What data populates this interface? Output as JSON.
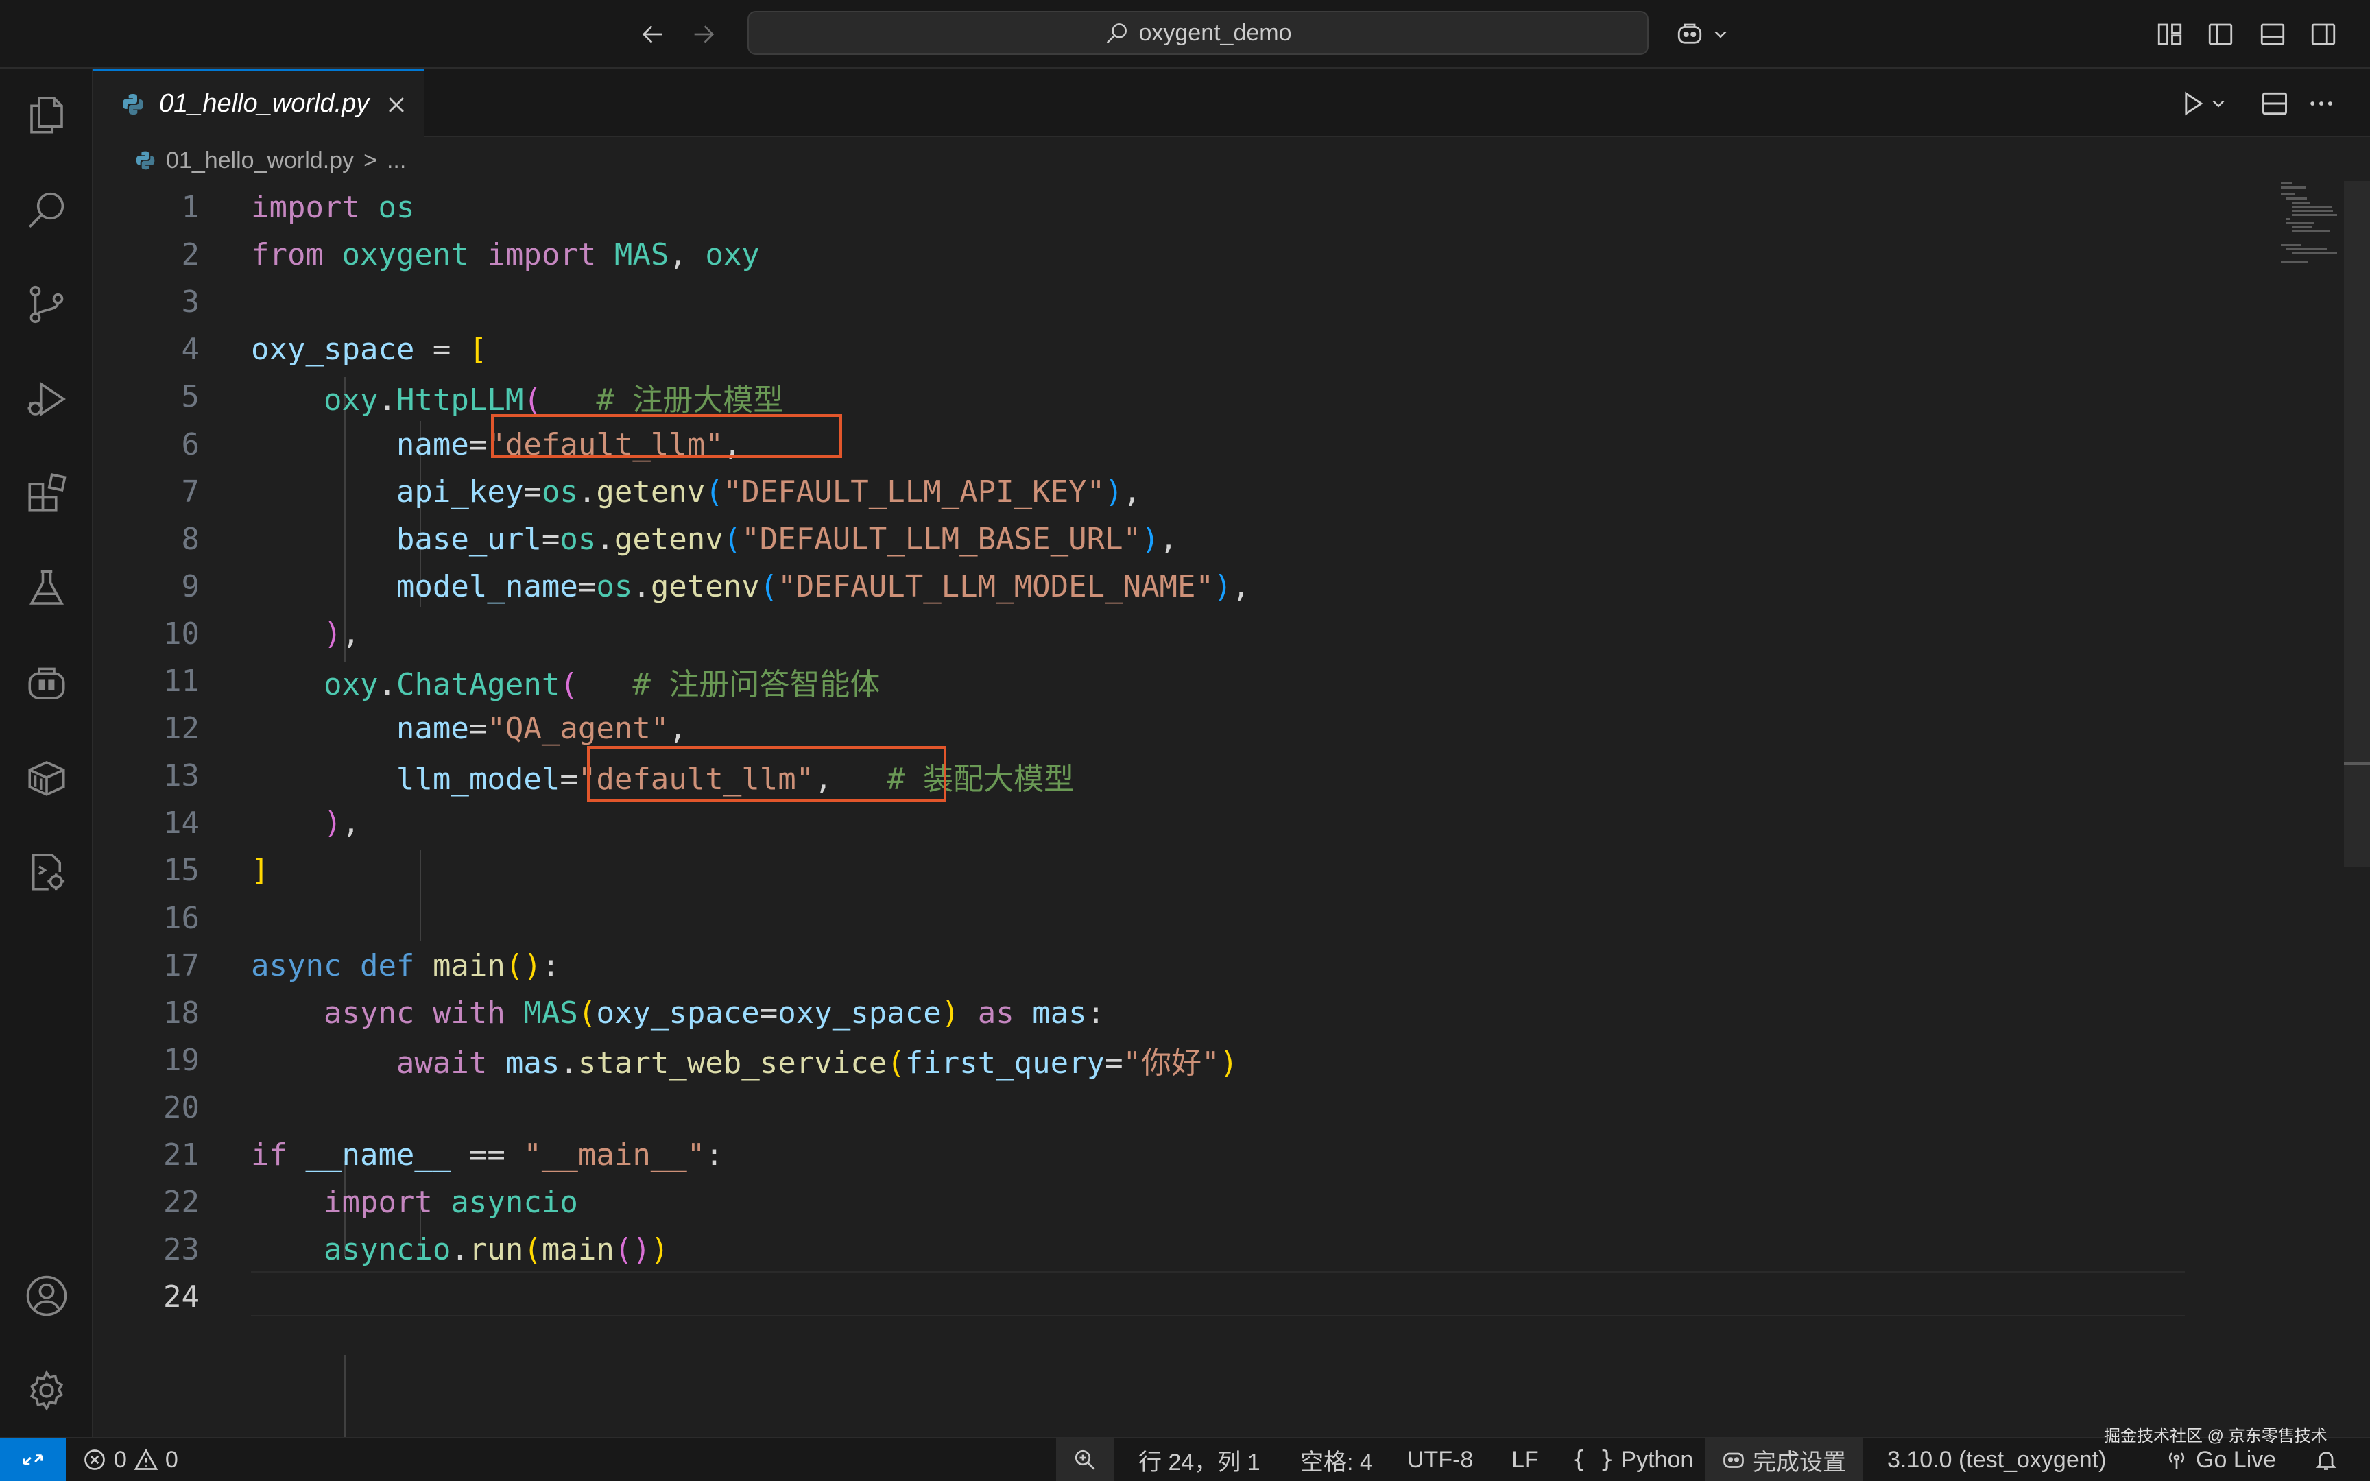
{
  "titlebar": {
    "search_text": "oxygent_demo"
  },
  "tab": {
    "filename": "01_hello_world.py"
  },
  "breadcrumb": {
    "file": "01_hello_world.py",
    "separator": ">",
    "more": "..."
  },
  "code": [
    {
      "n": "1",
      "t": [
        [
          "import",
          "#c586c0"
        ],
        [
          " ",
          ""
        ],
        [
          "os",
          "#4ec9b0"
        ]
      ]
    },
    {
      "n": "2",
      "t": [
        [
          "from",
          "#c586c0"
        ],
        [
          " ",
          ""
        ],
        [
          "oxygent",
          "#4ec9b0"
        ],
        [
          " ",
          ""
        ],
        [
          "import",
          "#c586c0"
        ],
        [
          " ",
          ""
        ],
        [
          "MAS",
          "#4ec9b0"
        ],
        [
          ", ",
          "#d4d4d4"
        ],
        [
          "oxy",
          "#4ec9b0"
        ]
      ]
    },
    {
      "n": "3",
      "t": []
    },
    {
      "n": "4",
      "t": [
        [
          "oxy_space",
          "#9cdcfe"
        ],
        [
          " = ",
          "#d4d4d4"
        ],
        [
          "[",
          "#ffd700"
        ]
      ]
    },
    {
      "n": "5",
      "t": [
        [
          "    ",
          ""
        ],
        [
          "oxy",
          "#4ec9b0"
        ],
        [
          ".",
          "#d4d4d4"
        ],
        [
          "HttpLLM",
          "#4ec9b0"
        ],
        [
          "(",
          "#da70d6"
        ],
        [
          "   ",
          ""
        ],
        [
          "# 注册大模型",
          "#6a9955"
        ]
      ]
    },
    {
      "n": "6",
      "t": [
        [
          "        ",
          ""
        ],
        [
          "name",
          "#9cdcfe"
        ],
        [
          "=",
          "#d4d4d4"
        ],
        [
          "\"default_llm\"",
          "#ce9178"
        ],
        [
          ",",
          "#d4d4d4"
        ]
      ]
    },
    {
      "n": "7",
      "t": [
        [
          "        ",
          ""
        ],
        [
          "api_key",
          "#9cdcfe"
        ],
        [
          "=",
          "#d4d4d4"
        ],
        [
          "os",
          "#4ec9b0"
        ],
        [
          ".",
          "#d4d4d4"
        ],
        [
          "getenv",
          "#dcdcaa"
        ],
        [
          "(",
          "#179fff"
        ],
        [
          "\"DEFAULT_LLM_API_KEY\"",
          "#ce9178"
        ],
        [
          ")",
          "#179fff"
        ],
        [
          ",",
          "#d4d4d4"
        ]
      ]
    },
    {
      "n": "8",
      "t": [
        [
          "        ",
          ""
        ],
        [
          "base_url",
          "#9cdcfe"
        ],
        [
          "=",
          "#d4d4d4"
        ],
        [
          "os",
          "#4ec9b0"
        ],
        [
          ".",
          "#d4d4d4"
        ],
        [
          "getenv",
          "#dcdcaa"
        ],
        [
          "(",
          "#179fff"
        ],
        [
          "\"DEFAULT_LLM_BASE_URL\"",
          "#ce9178"
        ],
        [
          ")",
          "#179fff"
        ],
        [
          ",",
          "#d4d4d4"
        ]
      ]
    },
    {
      "n": "9",
      "t": [
        [
          "        ",
          ""
        ],
        [
          "model_name",
          "#9cdcfe"
        ],
        [
          "=",
          "#d4d4d4"
        ],
        [
          "os",
          "#4ec9b0"
        ],
        [
          ".",
          "#d4d4d4"
        ],
        [
          "getenv",
          "#dcdcaa"
        ],
        [
          "(",
          "#179fff"
        ],
        [
          "\"DEFAULT_LLM_MODEL_NAME\"",
          "#ce9178"
        ],
        [
          ")",
          "#179fff"
        ],
        [
          ",",
          "#d4d4d4"
        ]
      ]
    },
    {
      "n": "10",
      "t": [
        [
          "    ",
          ""
        ],
        [
          ")",
          "#da70d6"
        ],
        [
          ",",
          "#d4d4d4"
        ]
      ]
    },
    {
      "n": "11",
      "t": [
        [
          "    ",
          ""
        ],
        [
          "oxy",
          "#4ec9b0"
        ],
        [
          ".",
          "#d4d4d4"
        ],
        [
          "ChatAgent",
          "#4ec9b0"
        ],
        [
          "(",
          "#da70d6"
        ],
        [
          "   ",
          ""
        ],
        [
          "# 注册问答智能体",
          "#6a9955"
        ]
      ]
    },
    {
      "n": "12",
      "t": [
        [
          "        ",
          ""
        ],
        [
          "name",
          "#9cdcfe"
        ],
        [
          "=",
          "#d4d4d4"
        ],
        [
          "\"QA_agent\"",
          "#ce9178"
        ],
        [
          ",",
          "#d4d4d4"
        ]
      ]
    },
    {
      "n": "13",
      "t": [
        [
          "        ",
          ""
        ],
        [
          "llm_model",
          "#9cdcfe"
        ],
        [
          "=",
          "#d4d4d4"
        ],
        [
          "\"default_llm\"",
          "#ce9178"
        ],
        [
          ",",
          "#d4d4d4"
        ],
        [
          "   ",
          ""
        ],
        [
          "# 装配大模型",
          "#6a9955"
        ]
      ]
    },
    {
      "n": "14",
      "t": [
        [
          "    ",
          ""
        ],
        [
          ")",
          "#da70d6"
        ],
        [
          ",",
          "#d4d4d4"
        ]
      ]
    },
    {
      "n": "15",
      "t": [
        [
          "]",
          "#ffd700"
        ]
      ]
    },
    {
      "n": "16",
      "t": []
    },
    {
      "n": "17",
      "t": [
        [
          "async",
          "#569cd6"
        ],
        [
          " ",
          ""
        ],
        [
          "def",
          "#569cd6"
        ],
        [
          " ",
          ""
        ],
        [
          "main",
          "#dcdcaa"
        ],
        [
          "()",
          "#ffd700"
        ],
        [
          ":",
          "#d4d4d4"
        ]
      ]
    },
    {
      "n": "18",
      "t": [
        [
          "    ",
          ""
        ],
        [
          "async",
          "#c586c0"
        ],
        [
          " ",
          ""
        ],
        [
          "with",
          "#c586c0"
        ],
        [
          " ",
          ""
        ],
        [
          "MAS",
          "#4ec9b0"
        ],
        [
          "(",
          "#ffd700"
        ],
        [
          "oxy_space",
          "#9cdcfe"
        ],
        [
          "=",
          "#d4d4d4"
        ],
        [
          "oxy_space",
          "#9cdcfe"
        ],
        [
          ")",
          "#ffd700"
        ],
        [
          " ",
          ""
        ],
        [
          "as",
          "#c586c0"
        ],
        [
          " ",
          ""
        ],
        [
          "mas",
          "#9cdcfe"
        ],
        [
          ":",
          "#d4d4d4"
        ]
      ]
    },
    {
      "n": "19",
      "t": [
        [
          "        ",
          ""
        ],
        [
          "await",
          "#c586c0"
        ],
        [
          " ",
          ""
        ],
        [
          "mas",
          "#9cdcfe"
        ],
        [
          ".",
          "#d4d4d4"
        ],
        [
          "start_web_service",
          "#dcdcaa"
        ],
        [
          "(",
          "#ffd700"
        ],
        [
          "first_query",
          "#9cdcfe"
        ],
        [
          "=",
          "#d4d4d4"
        ],
        [
          "\"你好\"",
          "#ce9178"
        ],
        [
          ")",
          "#ffd700"
        ]
      ]
    },
    {
      "n": "20",
      "t": []
    },
    {
      "n": "21",
      "t": [
        [
          "if",
          "#c586c0"
        ],
        [
          " ",
          ""
        ],
        [
          "__name__",
          "#9cdcfe"
        ],
        [
          " == ",
          "#d4d4d4"
        ],
        [
          "\"__main__\"",
          "#ce9178"
        ],
        [
          ":",
          "#d4d4d4"
        ]
      ]
    },
    {
      "n": "22",
      "t": [
        [
          "    ",
          ""
        ],
        [
          "import",
          "#c586c0"
        ],
        [
          " ",
          ""
        ],
        [
          "asyncio",
          "#4ec9b0"
        ]
      ]
    },
    {
      "n": "23",
      "t": [
        [
          "    ",
          ""
        ],
        [
          "asyncio",
          "#4ec9b0"
        ],
        [
          ".",
          "#d4d4d4"
        ],
        [
          "run",
          "#dcdcaa"
        ],
        [
          "(",
          "#ffd700"
        ],
        [
          "main",
          "#dcdcaa"
        ],
        [
          "()",
          "#da70d6"
        ],
        [
          ")",
          "#ffd700"
        ]
      ]
    },
    {
      "n": "24",
      "t": []
    }
  ],
  "statusbar": {
    "errors": "0",
    "warnings": "0",
    "position": "行 24，列 1",
    "spaces": "空格: 4",
    "encoding": "UTF-8",
    "eol": "LF",
    "braces": "{ }",
    "language": "Python",
    "copilot": "完成设置",
    "interpreter": "3.10.0 (test_oxygent)",
    "golive": "Go Live"
  },
  "watermark": "掘金技术社区 @ 京东零售技术"
}
